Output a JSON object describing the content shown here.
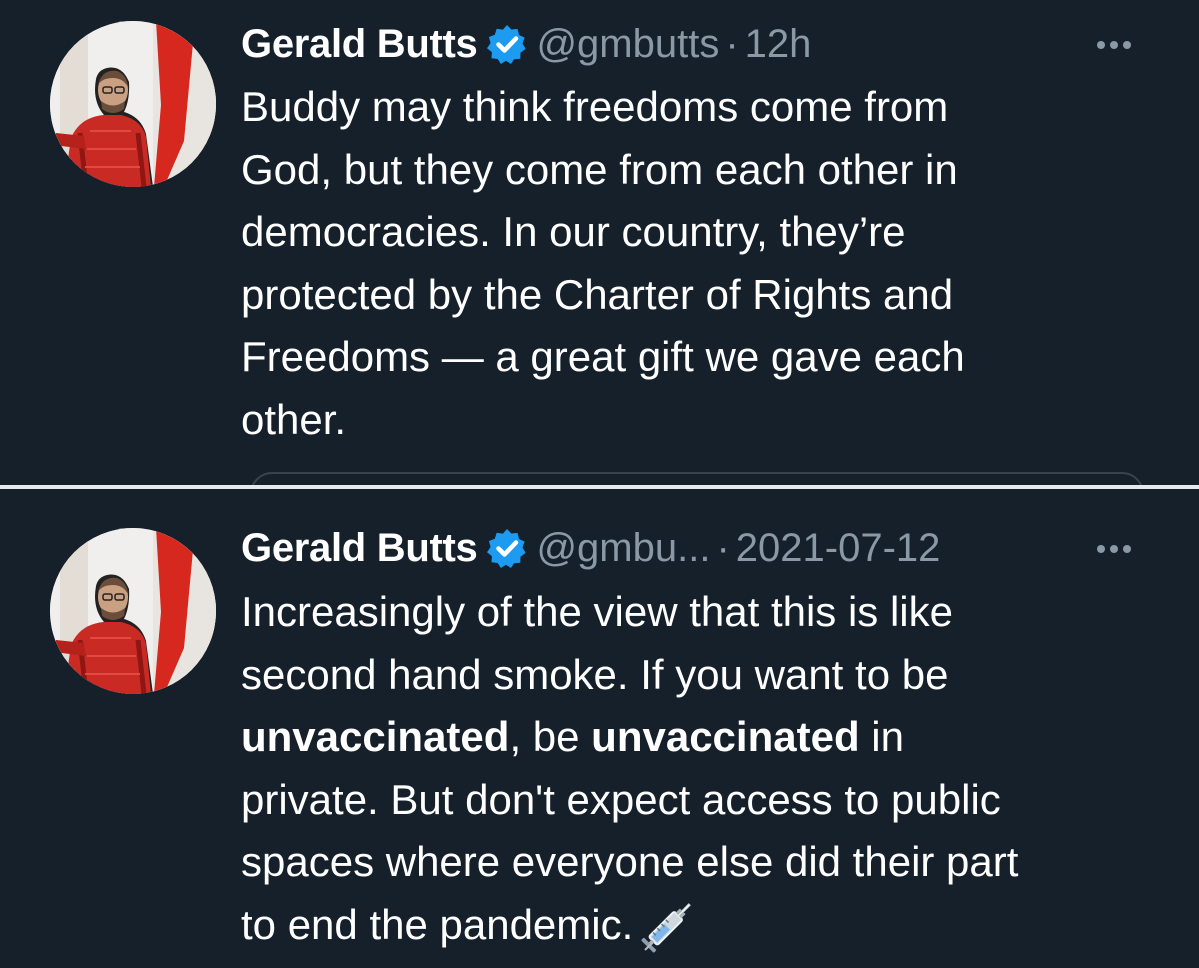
{
  "tweets": [
    {
      "author_name": "Gerald Butts",
      "handle": "@gmbutts",
      "separator": "·",
      "time": "12h",
      "text": "Buddy may think freedoms come from\nGod, but they come from each other in\ndemocracies. In our country, they’re\nprotected by the Charter of Rights and\nFreedoms — a great gift we gave each\nother."
    },
    {
      "author_name": "Gerald Butts",
      "handle": "@gmbu...",
      "separator": "·",
      "time": "2021-07-12",
      "text_segments": [
        "Increasingly of the view that this is like\nsecond hand smoke. If you want to be\n",
        "unvaccinated",
        ", be ",
        "unvaccinated",
        " in\nprivate. But don't expect access to public\nspaces where everyone else did their part\nto end the pandemic."
      ],
      "emoji": "syringe-icon"
    }
  ],
  "icons": {
    "verified": "verified-badge-icon",
    "more": "more-options-icon"
  },
  "colors": {
    "background": "#15202b",
    "text": "#ffffff",
    "secondary_text": "#8b98a5",
    "verified_blue": "#1d9bf0",
    "separator": "#e7e9ea"
  }
}
